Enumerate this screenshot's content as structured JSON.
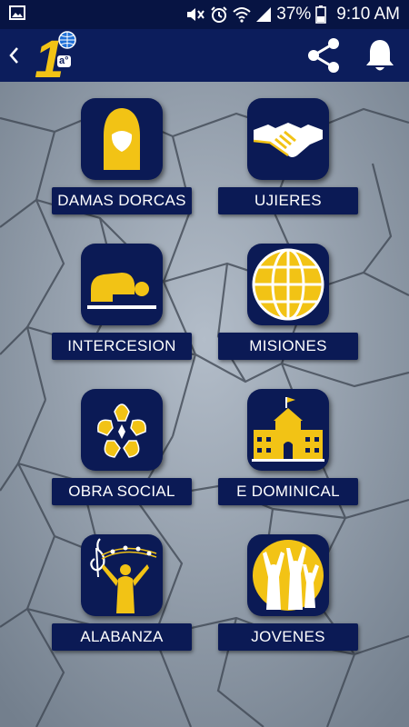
{
  "status_bar": {
    "battery": "37%",
    "time": "9:10 AM",
    "icons": [
      "image-icon",
      "mute-icon",
      "alarm-icon",
      "wifi-icon",
      "signal-icon",
      "battery-icon"
    ]
  },
  "app_bar": {
    "logo_number": "1",
    "logo_ordinal": "a°",
    "actions": [
      "share-icon",
      "bell-icon"
    ]
  },
  "menu": [
    {
      "label": "DAMAS DORCAS",
      "icon": "veiled-woman-icon"
    },
    {
      "label": "UJIERES",
      "icon": "handshake-icon"
    },
    {
      "label": "INTERCESION",
      "icon": "kneeling-prayer-icon"
    },
    {
      "label": "MISIONES",
      "icon": "globe-icon"
    },
    {
      "label": "OBRA SOCIAL",
      "icon": "hands-circle-icon"
    },
    {
      "label": "E DOMINICAL",
      "icon": "school-building-icon"
    },
    {
      "label": "ALABANZA",
      "icon": "music-worship-icon"
    },
    {
      "label": "JOVENES",
      "icon": "youth-worship-icon"
    }
  ],
  "colors": {
    "navy": "#0b1a55",
    "status_bar": "#071443",
    "gold": "#f2c315",
    "background": "#8f9ba8"
  }
}
